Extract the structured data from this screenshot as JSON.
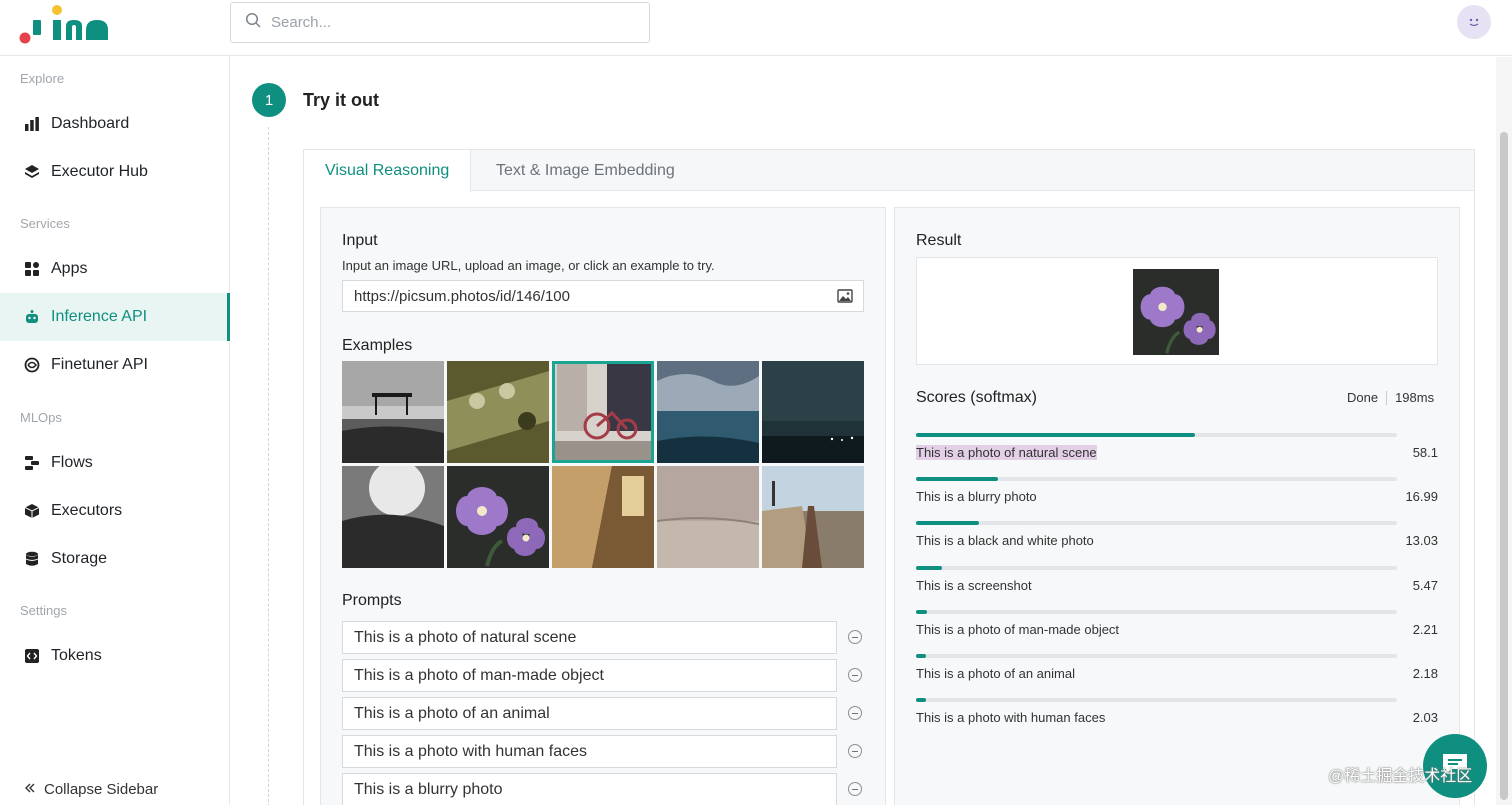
{
  "header": {
    "logo_text": "jina",
    "search_placeholder": "Search..."
  },
  "sidebar": {
    "sections": [
      {
        "label": "Explore"
      },
      {
        "label": "Services"
      },
      {
        "label": "MLOps"
      },
      {
        "label": "Settings"
      }
    ],
    "items": [
      {
        "label": "Dashboard",
        "icon": "bar-chart-icon"
      },
      {
        "label": "Executor Hub",
        "icon": "layers-icon"
      },
      {
        "label": "Apps",
        "icon": "apps-icon"
      },
      {
        "label": "Inference API",
        "icon": "robot-icon",
        "active": true
      },
      {
        "label": "Finetuner API",
        "icon": "spiral-icon"
      },
      {
        "label": "Flows",
        "icon": "flow-icon"
      },
      {
        "label": "Executors",
        "icon": "cube-icon"
      },
      {
        "label": "Storage",
        "icon": "database-icon"
      },
      {
        "label": "Tokens",
        "icon": "code-icon"
      }
    ],
    "collapse_label": "Collapse Sidebar"
  },
  "step": {
    "number": "1",
    "title": "Try it out"
  },
  "tabs": [
    {
      "label": "Visual Reasoning",
      "active": true
    },
    {
      "label": "Text & Image Embedding",
      "active": false
    }
  ],
  "input_panel": {
    "title": "Input",
    "hint": "Input an image URL, upload an image, or click an example to try.",
    "url_value": "https://picsum.photos/id/146/100",
    "examples_title": "Examples",
    "selected_example_index": 2,
    "prompts_title": "Prompts",
    "prompts": [
      "This is a photo of natural scene",
      "This is a photo of man-made object",
      "This is a photo of an animal",
      "This is a photo with human faces",
      "This is a blurry photo"
    ]
  },
  "result_panel": {
    "title": "Result",
    "scores_title": "Scores (softmax)",
    "status": "Done",
    "time": "198ms",
    "scores": [
      {
        "label": "This is a photo of natural scene",
        "value": "58.1",
        "fraction": 0.581,
        "highlighted": true
      },
      {
        "label": "This is a blurry photo",
        "value": "16.99",
        "fraction": 0.1699
      },
      {
        "label": "This is a black and white photo",
        "value": "13.03",
        "fraction": 0.1303
      },
      {
        "label": "This is a screenshot",
        "value": "5.47",
        "fraction": 0.0547
      },
      {
        "label": "This is a photo of man-made object",
        "value": "2.21",
        "fraction": 0.0221
      },
      {
        "label": "This is a photo of an animal",
        "value": "2.18",
        "fraction": 0.0218
      },
      {
        "label": "This is a photo with human faces",
        "value": "2.03",
        "fraction": 0.0203
      }
    ]
  },
  "watermark": "@稀土掘金技术社区",
  "colors": {
    "accent": "#0f8f7f",
    "highlight": "#e3cfe6"
  }
}
